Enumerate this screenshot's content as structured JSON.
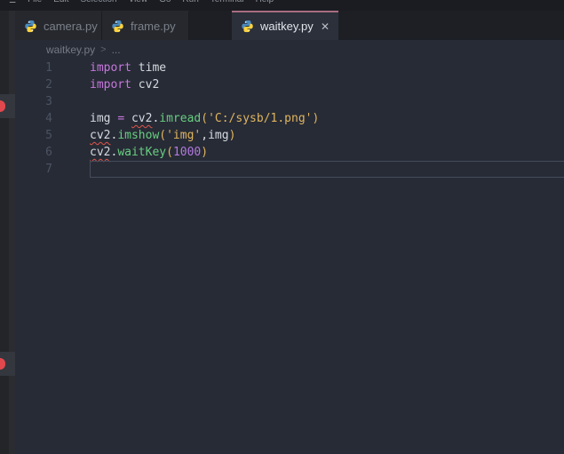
{
  "menubar": {
    "app_icon": "menu-icon",
    "items": [
      "File",
      "Edit",
      "Selection",
      "View",
      "Go",
      "Run",
      "Terminal",
      "Help"
    ]
  },
  "tabs": [
    {
      "label": "camera.py",
      "icon": "python-icon",
      "active": false
    },
    {
      "label": "frame.py",
      "icon": "python-icon",
      "active": false
    },
    {
      "label": "waitkey.py",
      "icon": "python-icon",
      "active": true,
      "gap_before": true,
      "close_label": "✕"
    }
  ],
  "breadcrumb": {
    "file": "waitkey.py",
    "separator": ">",
    "more": "..."
  },
  "editor": {
    "language": "python",
    "active_line": 7,
    "lines": [
      {
        "number": 1,
        "tokens": [
          {
            "c": "kw",
            "t": "import"
          },
          {
            "c": "id",
            "t": " time"
          }
        ]
      },
      {
        "number": 2,
        "tokens": [
          {
            "c": "kw",
            "t": "import"
          },
          {
            "c": "id",
            "t": " cv2"
          }
        ]
      },
      {
        "number": 3,
        "tokens": []
      },
      {
        "number": 4,
        "tokens": [
          {
            "c": "id",
            "t": "img "
          },
          {
            "c": "kw",
            "t": "="
          },
          {
            "c": "id",
            "t": " "
          },
          {
            "c": "id sq",
            "t": "cv2"
          },
          {
            "c": "id",
            "t": "."
          },
          {
            "c": "fn",
            "t": "imread"
          },
          {
            "c": "br",
            "t": "("
          },
          {
            "c": "str",
            "t": "'C:/sysb/1.png'"
          },
          {
            "c": "br",
            "t": ")"
          }
        ]
      },
      {
        "number": 5,
        "tokens": [
          {
            "c": "id sq",
            "t": "cv2"
          },
          {
            "c": "id",
            "t": "."
          },
          {
            "c": "fn",
            "t": "imshow"
          },
          {
            "c": "br",
            "t": "("
          },
          {
            "c": "str",
            "t": "'img'"
          },
          {
            "c": "id",
            "t": ",img"
          },
          {
            "c": "br",
            "t": ")"
          }
        ]
      },
      {
        "number": 6,
        "tokens": [
          {
            "c": "id sq",
            "t": "cv2"
          },
          {
            "c": "id",
            "t": "."
          },
          {
            "c": "fn",
            "t": "waitKey"
          },
          {
            "c": "br",
            "t": "("
          },
          {
            "c": "num",
            "t": "1000"
          },
          {
            "c": "br",
            "t": ")"
          }
        ]
      },
      {
        "number": 7,
        "tokens": []
      }
    ]
  },
  "rail": {
    "error_badge_count": 2
  },
  "colors": {
    "editor_bg": "#272b36",
    "menubar_bg": "#1b1c21",
    "menubar_text": "#8f949c",
    "tabbar_bg": "#1d1f25",
    "tab_inactive_bg": "#26282d",
    "tab_inactive_text": "#7b808a",
    "tab_active_bg": "#2b303b",
    "tab_active_text": "#e2e5ea",
    "accent_pink": "#a96e80",
    "rail_bg": "#242528",
    "rail_strip": "#2b2c31",
    "rail_item_bg": "#35373f",
    "badge_red": "#e1484d",
    "breadcrumb_text": "#747a85",
    "gutter": "#4c5363",
    "code_default": "#d6dae0",
    "kw": "#c678dd",
    "fn": "#68ce80",
    "strparen": "#e0b55e",
    "num": "#b279de",
    "squiggle": "#e0564a",
    "line_box": "#454c5b",
    "python_blue": "#4b8bbe",
    "python_yellow": "#ffd43b"
  }
}
